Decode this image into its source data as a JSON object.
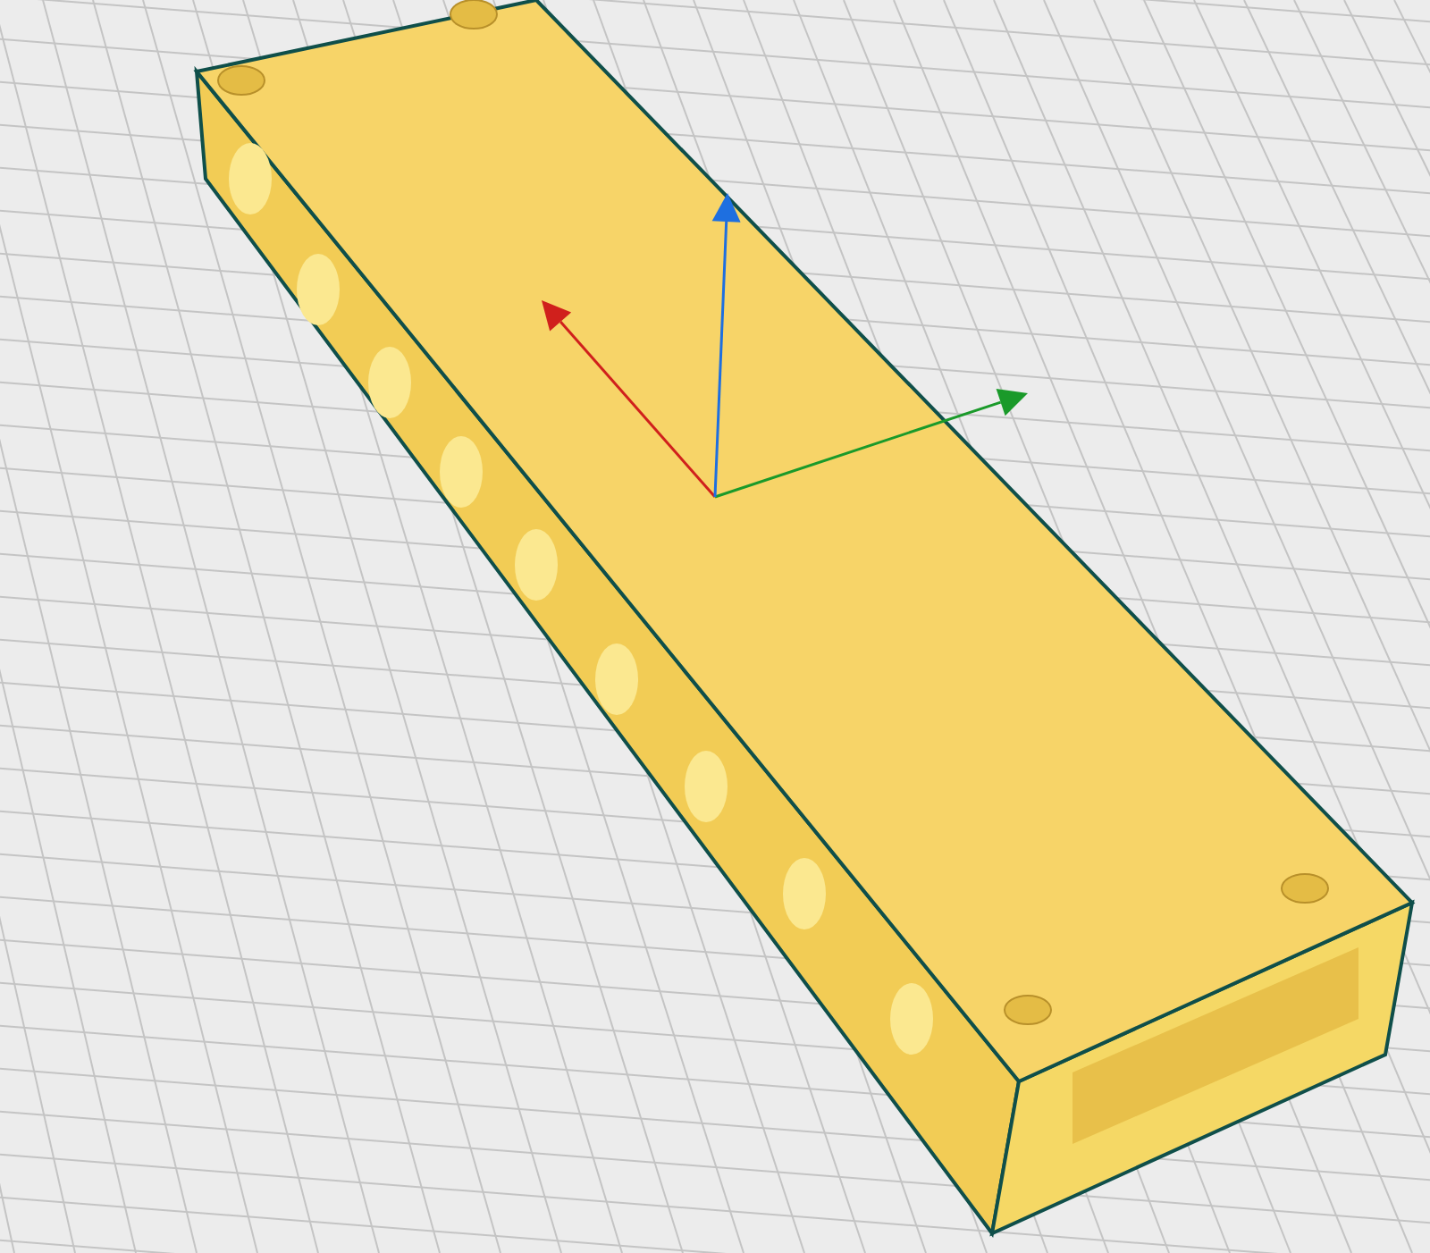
{
  "viewport": {
    "axes": [
      {
        "color": "#d0201c"
      },
      {
        "color": "#1a9a2a"
      },
      {
        "color": "#1e6fe0"
      }
    ]
  }
}
